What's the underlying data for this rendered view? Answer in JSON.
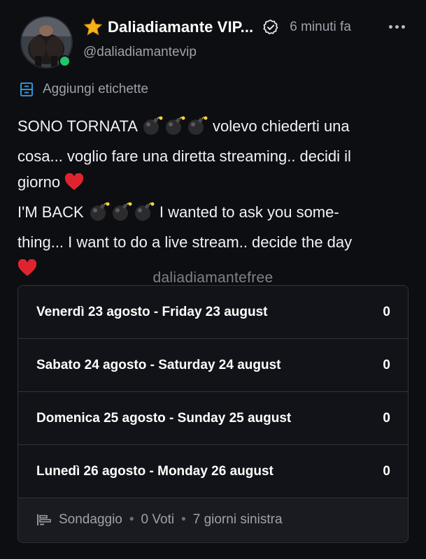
{
  "post": {
    "display_name": "Daliadiamante VIP...",
    "handle": "@daliadiamantevip",
    "time_ago": "6 minuti fa",
    "tags_label": "Aggiungi etichette",
    "text_lines": [
      "SONO TORNATA ",
      " volevo chiederti una",
      "cosa... voglio fare una diretta streaming.. decidi il",
      "giorno ",
      "I'M BACK ",
      " I wanted to ask you some-",
      "thing... I want to do a live stream.. decide the day"
    ],
    "watermark": "daliadiamantefree"
  },
  "poll": {
    "options": [
      {
        "label": "Venerdì 23 agosto - Friday 23 august",
        "votes": "0"
      },
      {
        "label": "Sabato 24 agosto - Saturday 24 august",
        "votes": "0"
      },
      {
        "label": "Domenica 25 agosto - Sunday 25 august",
        "votes": "0"
      },
      {
        "label": "Lunedì 26 agosto - Monday 26 august",
        "votes": "0"
      }
    ],
    "footer": {
      "type_label": "Sondaggio",
      "votes_label": "0 Voti",
      "remaining_label": "7 giorni sinistra"
    }
  },
  "icons": {
    "star": "star-icon",
    "verified": "verified-icon",
    "more": "more-options-icon",
    "tag": "tag-icon",
    "bomb": "bomb-icon",
    "heart": "heart-icon",
    "poll": "poll-icon"
  },
  "colors": {
    "background": "#0d0e12",
    "online": "#1fc66a",
    "tag_icon": "#3aa0e8",
    "heart": "#e0242f",
    "star": "#f5b21a"
  }
}
